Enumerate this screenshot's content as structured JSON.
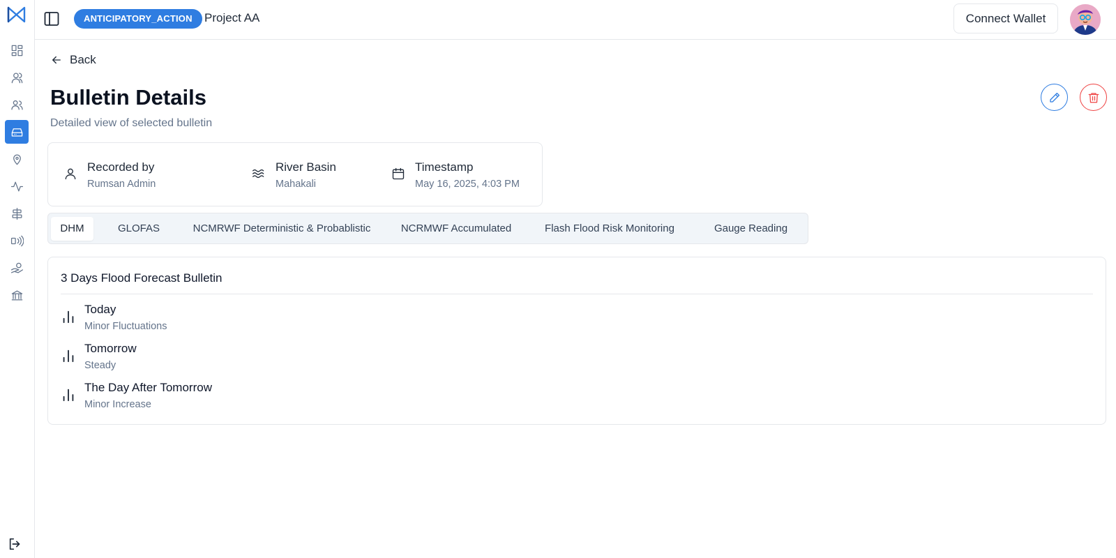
{
  "header": {
    "project_badge": "ANTICIPATORY_ACTION",
    "project_name": "Project AA",
    "connect_wallet_label": "Connect Wallet"
  },
  "sidebar": {
    "items": [
      {
        "icon": "dashboard-icon",
        "active": false
      },
      {
        "icon": "user-icon",
        "active": false
      },
      {
        "icon": "users-icon",
        "active": false
      },
      {
        "icon": "inbox-icon",
        "active": true
      },
      {
        "icon": "location-pin-icon",
        "active": false
      },
      {
        "icon": "activity-icon",
        "active": false
      },
      {
        "icon": "align-center-icon",
        "active": false
      },
      {
        "icon": "signal-icon",
        "active": false
      },
      {
        "icon": "hand-coins-icon",
        "active": false
      },
      {
        "icon": "bank-icon",
        "active": false
      }
    ],
    "logout_icon": "logout-icon"
  },
  "page": {
    "back_label": "Back",
    "title": "Bulletin Details",
    "subtitle": "Detailed view of selected bulletin"
  },
  "info": {
    "recorded_by_label": "Recorded by",
    "recorded_by_value": "Rumsan Admin",
    "river_basin_label": "River Basin",
    "river_basin_value": "Mahakali",
    "timestamp_label": "Timestamp",
    "timestamp_value": "May 16, 2025, 4:03 PM"
  },
  "tabs": [
    {
      "label": "DHM",
      "active": true
    },
    {
      "label": "GLOFAS",
      "active": false
    },
    {
      "label": "NCMRWF Deterministic & Probablistic",
      "active": false
    },
    {
      "label": "NCRMWF Accumulated",
      "active": false
    },
    {
      "label": "Flash Flood Risk Monitoring",
      "active": false
    },
    {
      "label": "Gauge Reading",
      "active": false
    }
  ],
  "forecast": {
    "title": "3 Days Flood Forecast Bulletin",
    "days": [
      {
        "label": "Today",
        "value": "Minor Fluctuations"
      },
      {
        "label": "Tomorrow",
        "value": "Steady"
      },
      {
        "label": "The Day After Tomorrow",
        "value": "Minor Increase"
      }
    ]
  },
  "colors": {
    "accent": "#2f7de1",
    "danger": "#ef4444",
    "muted_text": "#64748b"
  }
}
